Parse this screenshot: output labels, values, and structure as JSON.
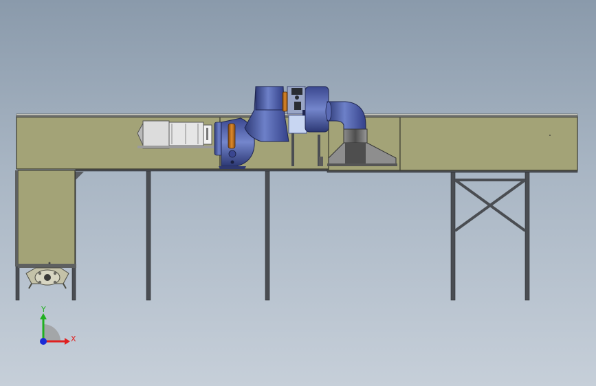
{
  "viewport": {
    "background_top": "#8a9aab",
    "background_bottom": "#c6cfd9"
  },
  "colors": {
    "duct_fill": "#a3a377",
    "frame_steel": "#4a4d52",
    "fan_blue": "#4d5fa8",
    "fan_blue_dark": "#2f3b78",
    "motor_orange": "#c8761e",
    "grey_box": "#d9d9d9",
    "hood_dark": "#5b5b5b",
    "axis_x": "#e02020",
    "axis_y": "#20b020",
    "axis_z": "#1a2ad6"
  },
  "triad": {
    "x_label": "X",
    "y_label": "Y"
  }
}
